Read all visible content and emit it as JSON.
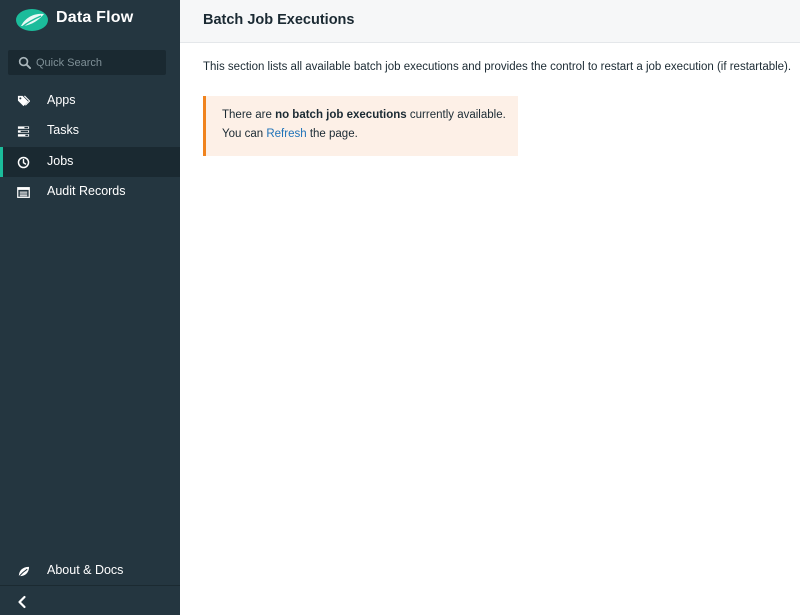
{
  "sidebar": {
    "brand": {
      "title": "Data Flow",
      "logo_icon": "spring-leaf-logo",
      "accent_color": "#1bbc9b"
    },
    "search": {
      "placeholder": "Quick Search",
      "value": ""
    },
    "items": [
      {
        "label": "Apps",
        "icon": "tags-icon",
        "active": false
      },
      {
        "label": "Tasks",
        "icon": "tasks-icon",
        "active": false
      },
      {
        "label": "Jobs",
        "icon": "clock-icon",
        "active": true
      },
      {
        "label": "Audit Records",
        "icon": "list-icon",
        "active": false
      }
    ],
    "footer": {
      "label": "About & Docs",
      "icon": "leaf-icon"
    },
    "collapse_icon": "chevron-left-icon"
  },
  "header": {
    "title": "Batch Job Executions"
  },
  "main": {
    "description": "This section lists all available batch job executions and provides the control to restart a job execution (if restartable).",
    "alert": {
      "line1_prefix": "There are ",
      "line1_bold": "no batch job executions",
      "line1_suffix": " currently available.",
      "line2_prefix": "You can ",
      "line2_link": "Refresh",
      "line2_suffix": " the page.",
      "accent_color": "#f0831e"
    }
  }
}
